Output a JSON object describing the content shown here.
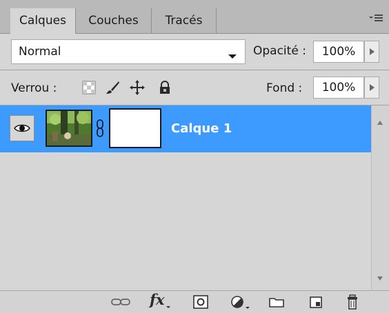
{
  "tabs": [
    {
      "label": "Calques",
      "active": true
    },
    {
      "label": "Couches",
      "active": false
    },
    {
      "label": "Tracés",
      "active": false
    }
  ],
  "blend_mode": {
    "value": "Normal"
  },
  "opacity": {
    "label": "Opacité :",
    "value": "100%"
  },
  "lock": {
    "label": "Verrou :",
    "icons": [
      "lock-transparent-pixels-icon",
      "lock-image-pixels-icon",
      "lock-position-icon",
      "lock-all-icon"
    ]
  },
  "fill": {
    "label": "Fond :",
    "value": "100%"
  },
  "layers": [
    {
      "name": "Calque 1",
      "visible": true,
      "selected": true,
      "has_mask": true
    }
  ],
  "toolbar_icons": [
    "link-layers-icon",
    "layer-style-fx-icon",
    "add-mask-icon",
    "adjustment-layer-icon",
    "new-group-icon",
    "new-layer-icon",
    "delete-layer-icon"
  ],
  "fx_text": "fx",
  "colors": {
    "selection": "#3d9bff",
    "panel_bg": "#d6d6d6",
    "tabbar_bg": "#b9b9b9"
  }
}
